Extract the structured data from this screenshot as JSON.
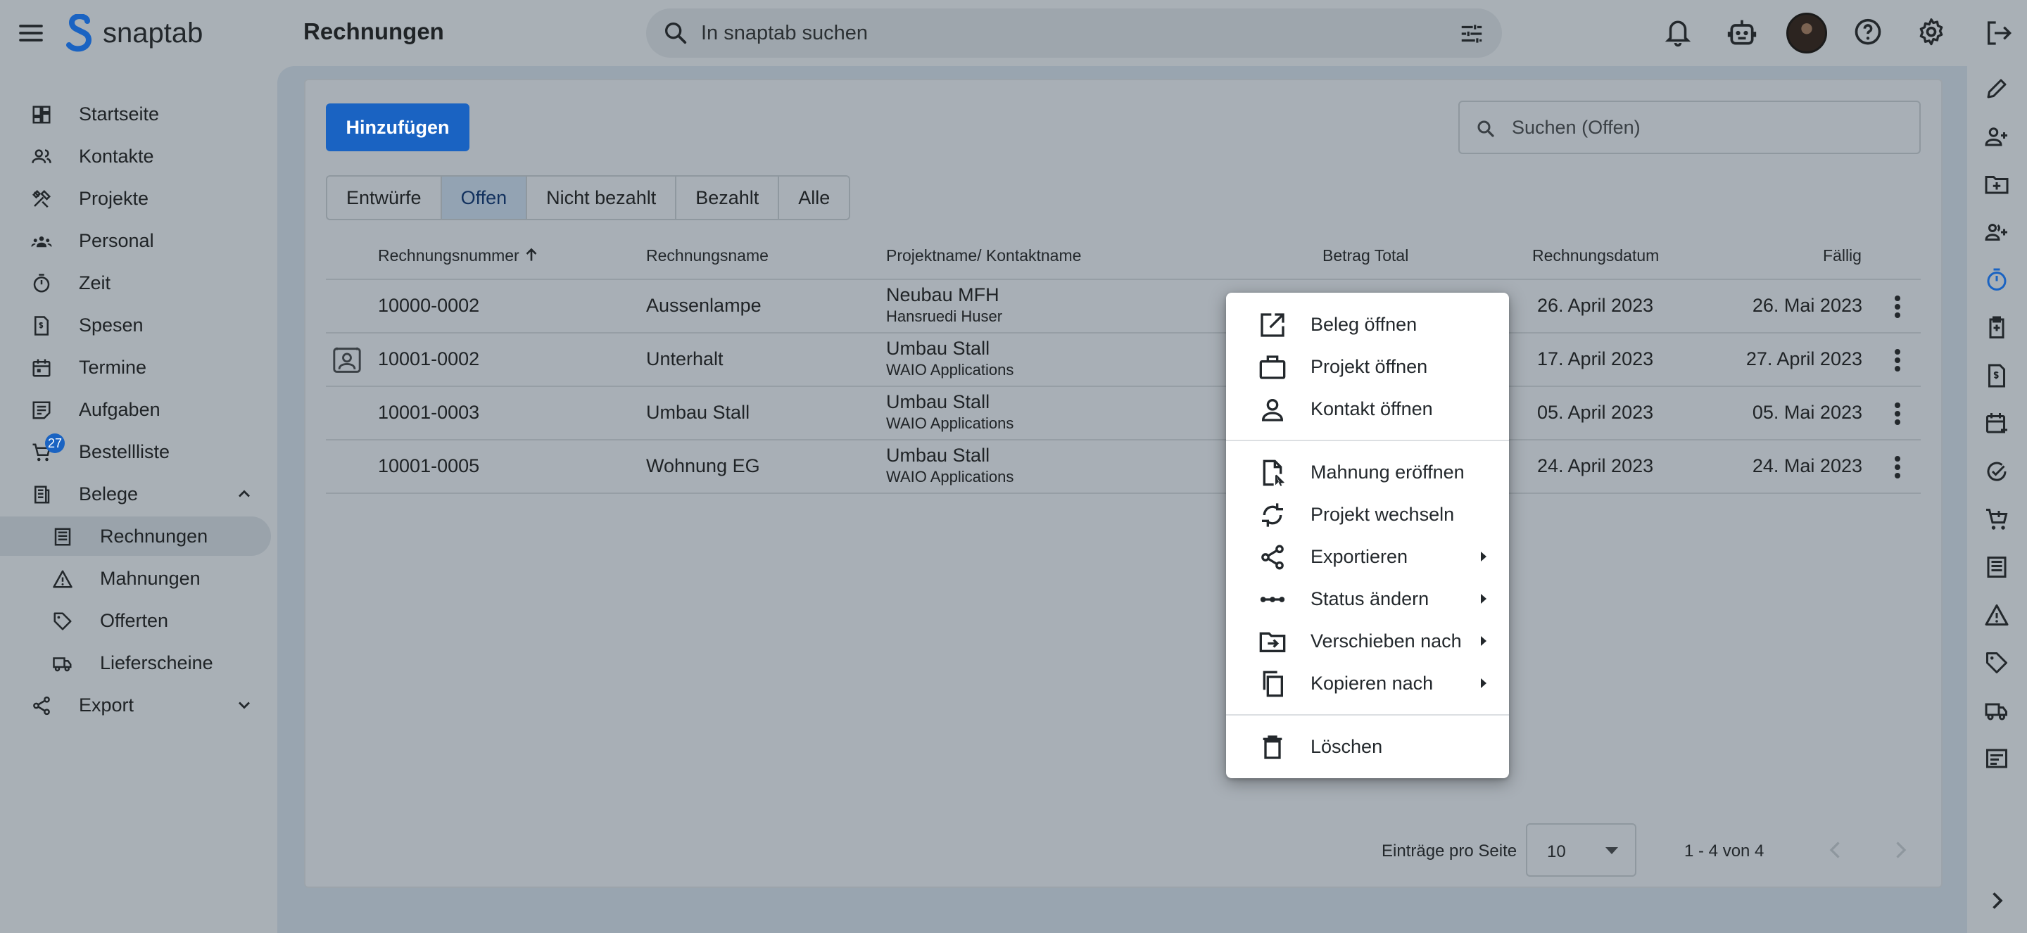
{
  "app": {
    "name": "snaptab",
    "page_title": "Rechnungen"
  },
  "search": {
    "placeholder": "In snaptab suchen"
  },
  "sidebar": {
    "items": [
      {
        "label": "Startseite",
        "icon": "dashboard-icon"
      },
      {
        "label": "Kontakte",
        "icon": "people-icon"
      },
      {
        "label": "Projekte",
        "icon": "tools-icon"
      },
      {
        "label": "Personal",
        "icon": "groups-icon"
      },
      {
        "label": "Zeit",
        "icon": "timer-icon"
      },
      {
        "label": "Spesen",
        "icon": "receipt-icon"
      },
      {
        "label": "Termine",
        "icon": "calendar-icon"
      },
      {
        "label": "Aufgaben",
        "icon": "tasks-icon"
      },
      {
        "label": "Bestellliste",
        "icon": "cart-icon",
        "badge": "27"
      },
      {
        "label": "Belege",
        "icon": "documents-icon"
      },
      {
        "label": "Rechnungen",
        "icon": "invoice-icon"
      },
      {
        "label": "Mahnungen",
        "icon": "warning-icon"
      },
      {
        "label": "Offerten",
        "icon": "tag-icon"
      },
      {
        "label": "Lieferscheine",
        "icon": "truck-icon"
      },
      {
        "label": "Export",
        "icon": "share-icon"
      }
    ]
  },
  "toolbar": {
    "add_label": "Hinzufügen",
    "filter_placeholder": "Suchen (Offen)"
  },
  "tabs": [
    {
      "label": "Entwürfe"
    },
    {
      "label": "Offen",
      "active": true
    },
    {
      "label": "Nicht bezahlt"
    },
    {
      "label": "Bezahlt"
    },
    {
      "label": "Alle"
    }
  ],
  "table": {
    "columns": {
      "number": "Rechnungsnummer",
      "name": "Rechnungsname",
      "project": "Projektname/ Kontaktname",
      "total": "Betrag Total",
      "date": "Rechnungsdatum",
      "due": "Fällig"
    },
    "rows": [
      {
        "number": "10000-0002",
        "name": "Aussenlampe",
        "project": "Neubau MFH",
        "contact": "Hansruedi Huser",
        "date": "26. April 2023",
        "due": "26. Mai 2023",
        "contact_card": false
      },
      {
        "number": "10001-0002",
        "name": "Unterhalt",
        "project": "Umbau Stall",
        "contact": "WAIO Applications",
        "date": "17. April 2023",
        "due": "27. April 2023",
        "contact_card": true
      },
      {
        "number": "10001-0003",
        "name": "Umbau Stall",
        "project": "Umbau Stall",
        "contact": "WAIO Applications",
        "date": "05. April 2023",
        "due": "05. Mai 2023",
        "contact_card": false
      },
      {
        "number": "10001-0005",
        "name": "Wohnung EG",
        "project": "Umbau Stall",
        "contact": "WAIO Applications",
        "date": "24. April 2023",
        "due": "24. Mai 2023",
        "contact_card": false
      }
    ]
  },
  "pagination": {
    "per_page_label": "Einträge pro Seite",
    "per_page_value": "10",
    "range": "1 - 4 von 4"
  },
  "context_menu": {
    "items": [
      {
        "label": "Beleg öffnen",
        "icon": "open-in-new-icon"
      },
      {
        "label": "Projekt öffnen",
        "icon": "briefcase-icon"
      },
      {
        "label": "Kontakt öffnen",
        "icon": "person-icon"
      },
      {
        "label": "Mahnung eröffnen",
        "icon": "document-cursor-icon"
      },
      {
        "label": "Projekt wechseln",
        "icon": "sync-icon"
      },
      {
        "label": "Exportieren",
        "icon": "share-icon",
        "submenu": true
      },
      {
        "label": "Status ändern",
        "icon": "status-dots-icon",
        "submenu": true
      },
      {
        "label": "Verschieben nach",
        "icon": "folder-move-icon",
        "submenu": true
      },
      {
        "label": "Kopieren nach",
        "icon": "copy-icon",
        "submenu": true
      },
      {
        "label": "Löschen",
        "icon": "trash-icon"
      }
    ]
  },
  "colors": {
    "accent": "#1a63c2",
    "scrim_background": "#a9b0b6",
    "menu_background": "#ffffff"
  }
}
